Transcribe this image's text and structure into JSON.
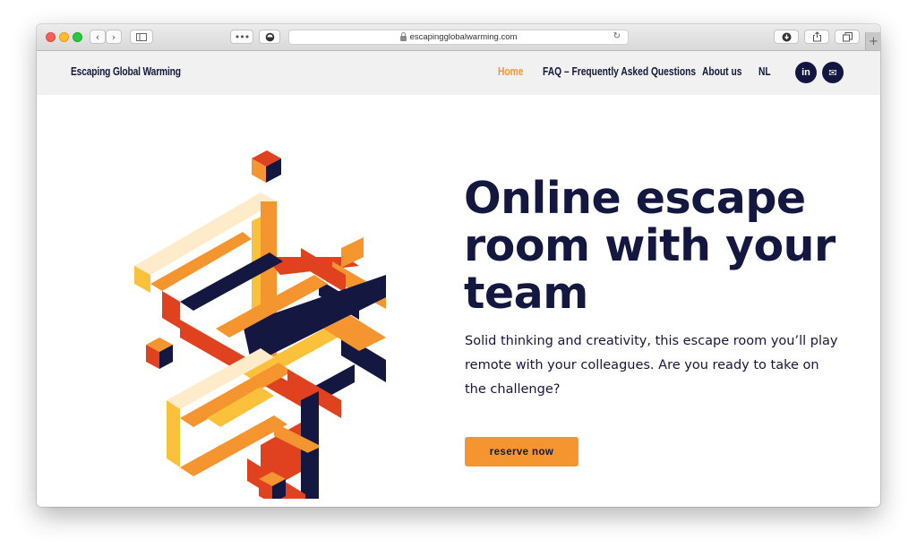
{
  "browser": {
    "url": "escapingglobalwarming.com"
  },
  "site": {
    "logo": "Escaping Global Warming",
    "nav": [
      {
        "label": "Home",
        "active": true
      },
      {
        "label": "FAQ – Frequently Asked Questions",
        "active": false
      },
      {
        "label": "About us",
        "active": false
      },
      {
        "label": "NL",
        "active": false
      }
    ],
    "social": [
      {
        "icon": "linkedin-icon",
        "glyph": "in"
      },
      {
        "icon": "envelope-icon",
        "glyph": "✉"
      }
    ]
  },
  "hero": {
    "title": "Online escape room with your team",
    "text": "Solid thinking and creativity, this escape room you’ll play remote with your colleagues. Are you ready to take on the challenge?",
    "cta_label": "reserve now"
  },
  "colors": {
    "navy": "#14173f",
    "orange": "#f5952f",
    "red": "#e0421f",
    "yellow": "#fcc13a",
    "cream": "#fdebc9"
  }
}
